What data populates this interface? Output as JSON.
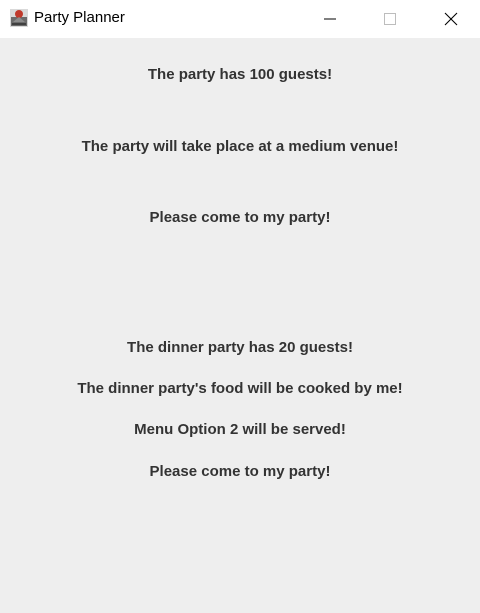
{
  "window": {
    "title": "Party Planner",
    "icon": "app-java-icon"
  },
  "controls": {
    "minimize_icon": "minimize-icon",
    "maximize_icon": "maximize-icon",
    "close_icon": "close-icon"
  },
  "party": {
    "guests": "The party has 100 guests!",
    "venue": "The party will take place at a medium venue!",
    "invite": "Please come to my party!"
  },
  "dinner_party": {
    "guests": "The dinner party has 20 guests!",
    "food": "The dinner party's food will be cooked by me!",
    "menu": "Menu Option 2 will be served!",
    "invite": "Please come to my party!"
  },
  "colors": {
    "background": "#eeeeee",
    "titlebar": "#ffffff",
    "text": "#333333"
  }
}
